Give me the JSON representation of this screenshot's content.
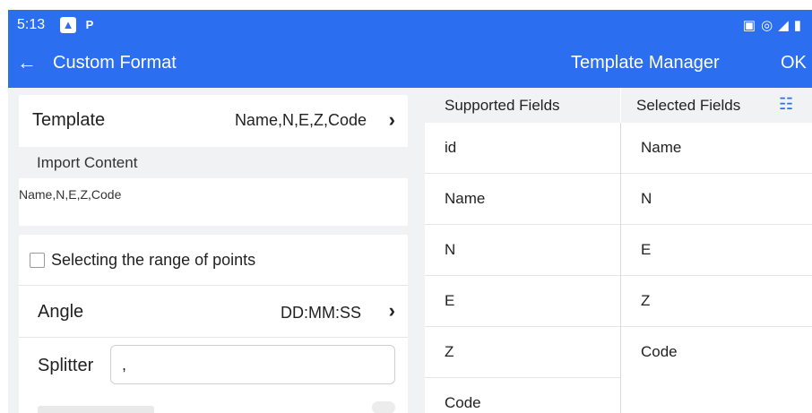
{
  "status_bar": {
    "time": "5:13",
    "icons": [
      "gallery-icon",
      "p-badge-icon"
    ],
    "right_icons": [
      "cast-icon",
      "hotspot-icon",
      "signal-icon",
      "battery-icon"
    ]
  },
  "app_bar": {
    "title": "Custom Format",
    "template_manager": "Template Manager",
    "ok": "OK"
  },
  "left_panel": {
    "template_label": "Template",
    "template_value": "Name,N,E,Z,Code",
    "import_content_label": "Import Content",
    "import_content_value": "Name,N,E,Z,Code",
    "range_checkbox_label": "Selecting the range of points",
    "range_checked": false,
    "angle_label": "Angle",
    "angle_value": "DD:MM:SS",
    "splitter_label": "Splitter",
    "splitter_value": ","
  },
  "fields": {
    "supported_header": "Supported Fields",
    "selected_header": "Selected Fields",
    "supported": [
      "id",
      "Name",
      "N",
      "E",
      "Z",
      "Code"
    ],
    "selected": [
      "Name",
      "N",
      "E",
      "Z",
      "Code"
    ]
  },
  "colors": {
    "accent": "#2b6ef0",
    "background": "#f1f2f4"
  }
}
